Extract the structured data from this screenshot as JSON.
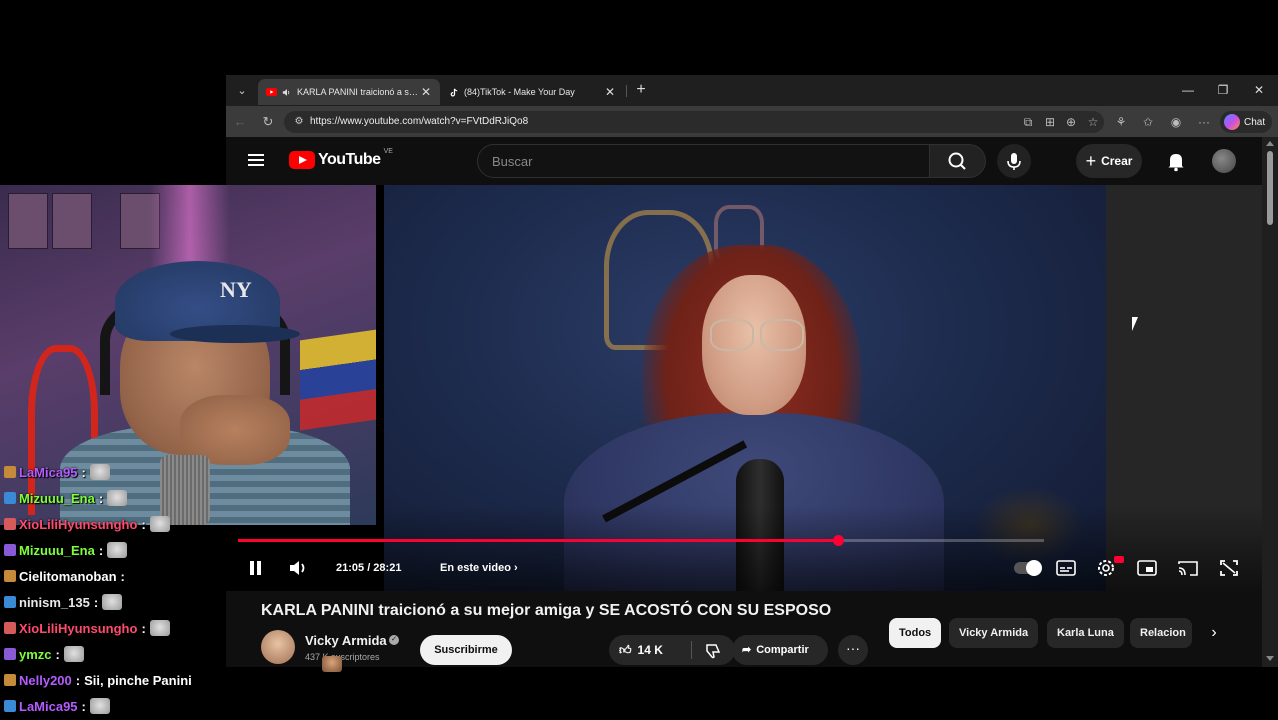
{
  "browser": {
    "tabs": [
      {
        "title": "KARLA PANINI traicionó a su mejor amiga y SE ACOSTÓ CON SU ESPOSO - YouTube",
        "active": true,
        "favicon": "youtube-icon",
        "audio": "speaker-icon"
      },
      {
        "title": "(84)TikTok - Make Your Day",
        "active": false,
        "favicon": "tiktok-icon"
      }
    ],
    "url": "https://www.youtube.com/watch?v=FVtDdRJiQo8",
    "copilot_label": "Chat"
  },
  "youtube": {
    "logo_text": "YouTube",
    "country_code": "VE",
    "search_placeholder": "Buscar",
    "create_label": "Crear"
  },
  "player": {
    "current_time": "21:05",
    "duration": "28:21",
    "time_display": "21:05 / 28:21",
    "progress_fraction": 0.744,
    "chapter_label": "En este video"
  },
  "video": {
    "title": "KARLA PANINI traicionó a su mejor amiga y SE ACOSTÓ CON SU ESPOSO",
    "channel": "Vicky Armida",
    "subscribers": "437 K suscriptores",
    "subscribe_label": "Suscribirme",
    "likes": "14 K",
    "share_label": "Compartir",
    "more_label": "···"
  },
  "chips": [
    "Todos",
    "Vicky Armida",
    "Karla Luna",
    "Relacion"
  ],
  "chat": [
    {
      "user": "LaMica95",
      "color": "#b45cff",
      "text": "",
      "emote": "cat"
    },
    {
      "user": "Mizuuu_Ena",
      "color": "#7cff3a",
      "text": "",
      "emote": "cat"
    },
    {
      "user": "XioLiliHyunsungho",
      "color": "#ff4a6e",
      "text": "",
      "emote": "cat"
    },
    {
      "user": "Mizuuu_Ena",
      "color": "#7cff3a",
      "text": "",
      "emote": "cat"
    },
    {
      "user": "Cielitomanoban",
      "color": "#ffffff",
      "text": "",
      "emote": "face"
    },
    {
      "user": "ninism_135",
      "color": "#e8e8e8",
      "text": "",
      "emote": "cat"
    },
    {
      "user": "XioLiliHyunsungho",
      "color": "#ff4a6e",
      "text": "",
      "emote": "cat"
    },
    {
      "user": "ymzc",
      "color": "#7cff3a",
      "text": "",
      "emote": "cat"
    },
    {
      "user": "Nelly200",
      "color": "#b45cff",
      "text": "Sii, pinche Panini",
      "emote": ""
    },
    {
      "user": "LaMica95",
      "color": "#b45cff",
      "text": "",
      "emote": "cat"
    }
  ],
  "colors": {
    "youtube_red": "#ff0000",
    "progress_red": "#ff0033",
    "page_bg": "#0f0f0f"
  }
}
